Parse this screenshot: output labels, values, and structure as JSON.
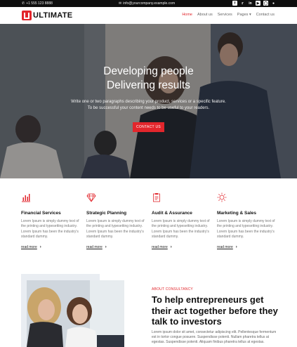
{
  "topbar": {
    "phone": "+1 555 123 8888",
    "email": "info@yourcompany.example.com",
    "socials": [
      "facebook-icon",
      "twitter-icon",
      "linkedin-icon",
      "youtube-icon",
      "instagram-icon",
      "github-icon"
    ]
  },
  "brand": {
    "name": "ULTIMATE",
    "accent": "#e2262c"
  },
  "nav": {
    "items": [
      {
        "label": "Home",
        "active": true
      },
      {
        "label": "About us"
      },
      {
        "label": "Services"
      },
      {
        "label": "Pages"
      },
      {
        "label": "Contact us"
      }
    ]
  },
  "hero": {
    "title_line1": "Developing people",
    "title_line2": "Delivering results",
    "sub_line1": "Write one or two paragraphs describing your product, services or a specific feature.",
    "sub_line2": "To be successful your content needs to be useful to your readers.",
    "button": "CONTACT US"
  },
  "services": [
    {
      "icon": "chart-icon",
      "title": "Financial Services",
      "desc": "Lorem Ipsum is simply dummy text of the printing and typesetting industry. Lorem Ipsum has been the industry's standard dummy.",
      "more": "read more"
    },
    {
      "icon": "diamond-icon",
      "title": "Strategic Planning",
      "desc": "Lorem Ipsum is simply dummy text of the printing and typesetting industry. Lorem Ipsum has been the industry's standard dummy.",
      "more": "read more"
    },
    {
      "icon": "clipboard-icon",
      "title": "Audit & Assurance",
      "desc": "Lorem Ipsum is simply dummy text of the printing and typesetting industry. Lorem Ipsum has been the industry's standard dummy.",
      "more": "read more"
    },
    {
      "icon": "sun-icon",
      "title": "Marketing & Sales",
      "desc": "Lorem Ipsum is simply dummy text of the printing and typesetting industry. Lorem Ipsum has been the industry's standard dummy.",
      "more": "read more"
    }
  ],
  "about": {
    "eyebrow": "ABOUT CONSULTANCY",
    "heading": "To help entrepreneurs get their act together before they talk to investors",
    "paragraph": "Lorem ipsum dolor sit amet, consectetur adipiscing elit. Pellentesque fermentum est in tortor congue posuere. Suspendisse potenti. Nullam pharetra tellus at egestas. Suspendisse potenti. Aliquam finibus pharetra tellus at egestas."
  }
}
